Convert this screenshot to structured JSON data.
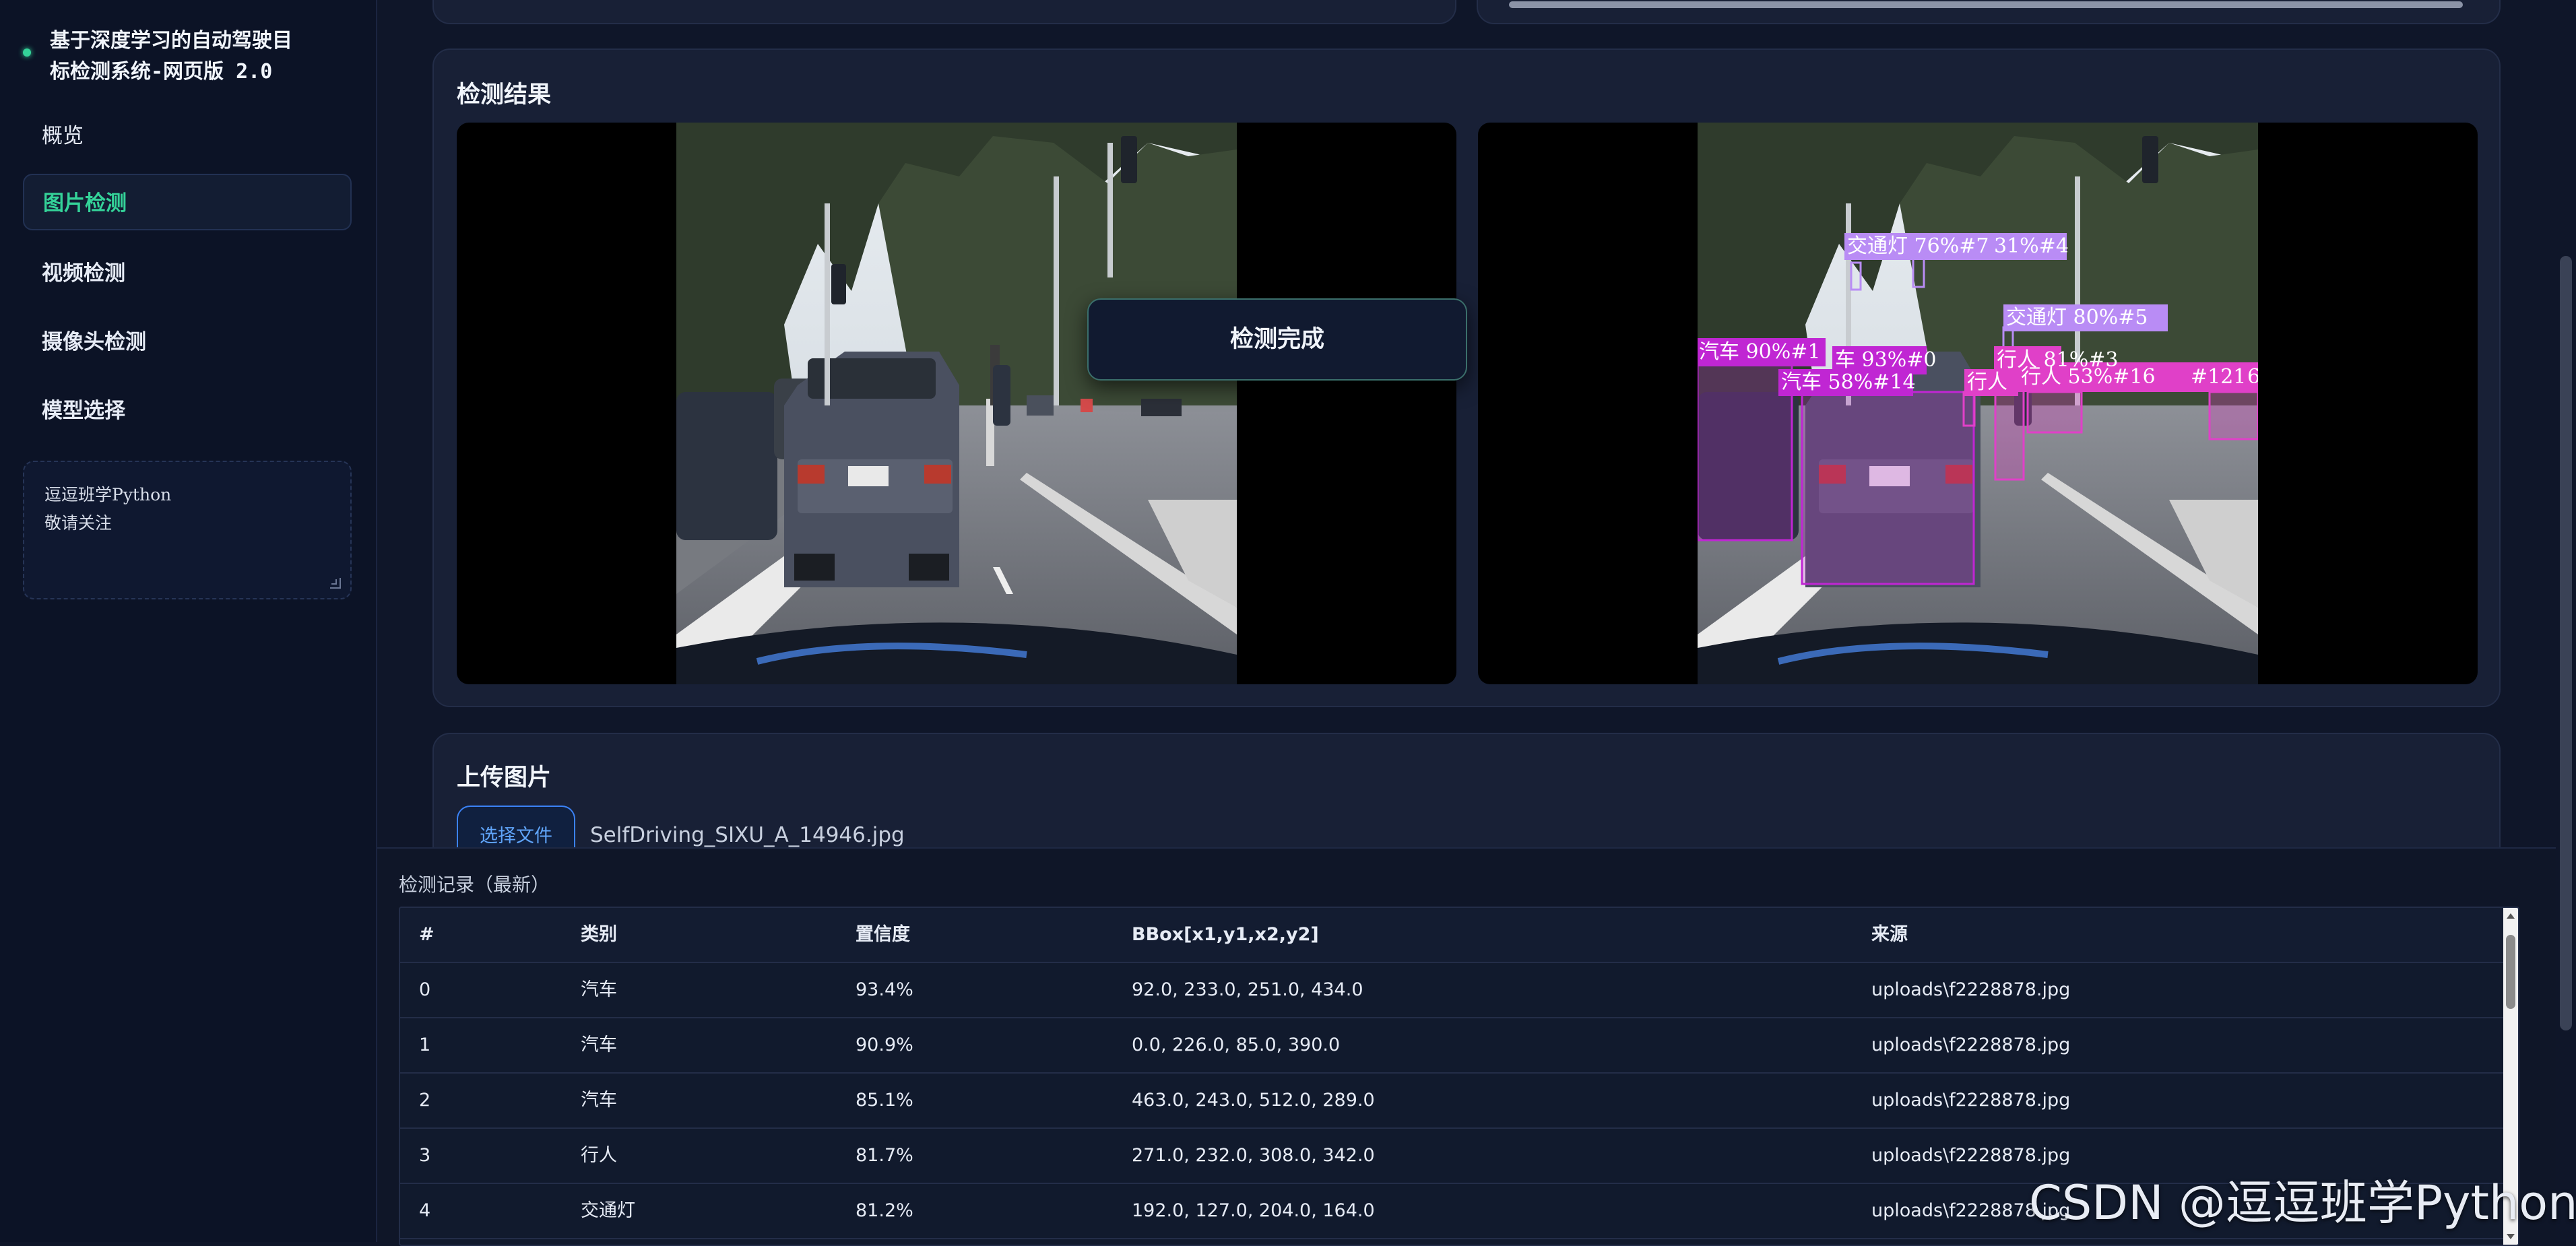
{
  "sidebar": {
    "title": "基于深度学习的自动驾驶目标检测系统-网页版 2.0",
    "title_lines": [
      "基于深度学习的自动驾驶目",
      "标检测系统-网页版 2.0"
    ],
    "nav": [
      {
        "label": "概览",
        "active": false
      },
      {
        "label": "图片检测",
        "active": true
      },
      {
        "label": "视频检测",
        "active": false
      },
      {
        "label": "摄像头检测",
        "active": false
      },
      {
        "label": "模型选择",
        "active": false
      }
    ],
    "note_lines": [
      "逗逗班学Python",
      "敬请关注"
    ]
  },
  "results": {
    "title": "检测结果",
    "toast": "检测完成",
    "labels": [
      "交通灯 76%#7",
      "31%#4",
      "交通灯 80%#5",
      "汽车 90%#1",
      "车 93%#0",
      "汽车 58%#14",
      "行人 81%#3",
      "行人",
      "行人 53%#16",
      "#121",
      "6"
    ]
  },
  "upload": {
    "title": "上传图片",
    "button_label": "选择文件",
    "file_name": "SelfDriving_SIXU_A_14946.jpg"
  },
  "records": {
    "title": "检测记录（最新）",
    "columns": [
      "#",
      "类别",
      "置信度",
      "BBox[x1,y1,x2,y2]",
      "来源"
    ],
    "rows": [
      [
        "0",
        "汽车",
        "93.4%",
        "92.0, 233.0, 251.0, 434.0",
        "uploads\\f2228878.jpg"
      ],
      [
        "1",
        "汽车",
        "90.9%",
        "0.0, 226.0, 85.0, 390.0",
        "uploads\\f2228878.jpg"
      ],
      [
        "2",
        "汽车",
        "85.1%",
        "463.0, 243.0, 512.0, 289.0",
        "uploads\\f2228878.jpg"
      ],
      [
        "3",
        "行人",
        "81.7%",
        "271.0, 232.0, 308.0, 342.0",
        "uploads\\f2228878.jpg"
      ],
      [
        "4",
        "交通灯",
        "81.2%",
        "192.0, 127.0, 204.0, 164.0",
        "uploads\\f2228878.jpg"
      ]
    ]
  },
  "watermark": "CSDN @逗逗班学Python",
  "colors": {
    "accent_green": "#34d399",
    "accent_blue": "#3b82f6",
    "box_car": "#c026d3",
    "box_light": "#b98cf5",
    "box_person": "#e040c8"
  }
}
